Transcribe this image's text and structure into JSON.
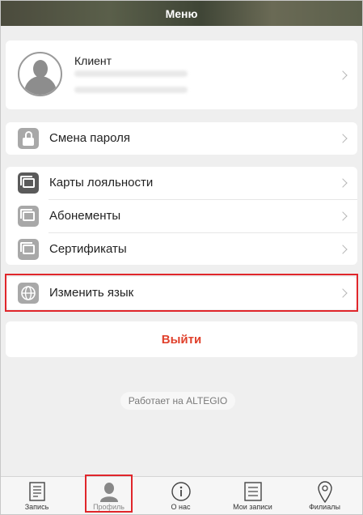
{
  "header": {
    "title": "Меню"
  },
  "profile": {
    "name": "Клиент",
    "phone": "+7(XXX)XXX-XX-XX",
    "email": "xxx@example.com"
  },
  "menu": {
    "change_password": "Смена пароля",
    "loyalty_cards": "Карты лояльности",
    "subscriptions": "Абонементы",
    "certificates": "Сертификаты",
    "change_language": "Изменить язык",
    "logout": "Выйти"
  },
  "powered_by": "Работает на ALTEGIO",
  "tabs": [
    {
      "label": "Запись",
      "icon": "booking-icon"
    },
    {
      "label": "Профиль",
      "icon": "profile-icon"
    },
    {
      "label": "О нас",
      "icon": "info-icon"
    },
    {
      "label": "Мои записи",
      "icon": "list-icon"
    },
    {
      "label": "Филиалы",
      "icon": "location-icon"
    }
  ],
  "colors": {
    "accent_red": "#e0412c",
    "highlight": "#e0262b"
  }
}
